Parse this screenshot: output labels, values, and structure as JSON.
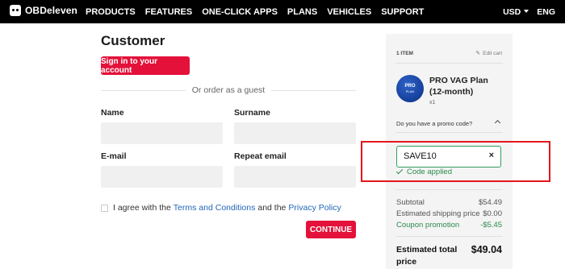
{
  "brand": {
    "name": "OBDeleven"
  },
  "nav": [
    "PRODUCTS",
    "FEATURES",
    "ONE-CLICK APPS",
    "PLANS",
    "VEHICLES",
    "SUPPORT"
  ],
  "header_right": {
    "currency": "USD",
    "language": "ENG"
  },
  "customer": {
    "title": "Customer",
    "signin_label": "Sign in to your account",
    "guest_text": "Or order as a guest",
    "name_label": "Name",
    "surname_label": "Surname",
    "email_label": "E-mail",
    "repeat_email_label": "Repeat email",
    "agree_prefix": "I agree with the",
    "terms_link": "Terms and Conditions",
    "agree_mid": "and the",
    "privacy_link": "Privacy Policy",
    "continue_label": "CONTINUE"
  },
  "cart": {
    "item_count": "1 ITEM",
    "edit_label": "Edit cart",
    "product": {
      "name": "PRO VAG Plan (12-month)",
      "qty": "x1",
      "image_title": "PRO",
      "image_sub": "PLAN"
    },
    "promo_question": "Do you have a promo code?",
    "promo_code": "SAVE10",
    "promo_clear": "×",
    "promo_status": "Code applied",
    "subtotal_label": "Subtotal",
    "subtotal_value": "$54.49",
    "shipping_label": "Estimated shipping price",
    "shipping_value": "$0.00",
    "coupon_label": "Coupon promotion",
    "coupon_value": "-$5.45",
    "total_label": "Estimated total price",
    "total_value": "$49.04"
  },
  "colors": {
    "accent": "#e4113a",
    "success": "#2b8a4e",
    "link": "#2366b8",
    "highlight": "#e4161b"
  }
}
